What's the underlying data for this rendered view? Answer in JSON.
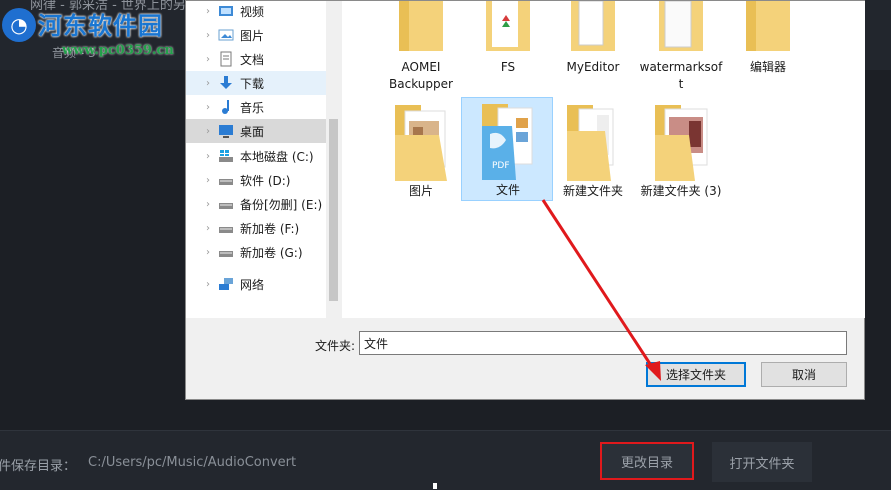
{
  "background_app": {
    "song_title": "网律 - 郭采洁 - 世界上的另",
    "row_text": "音频 - 3",
    "save_dir_label": "件保存目录：",
    "save_dir_path": "C:/Users/pc/Music/AudioConvert",
    "change_dir_button": "更改目录",
    "open_folder_button": "打开文件夹"
  },
  "watermark": {
    "title": "河东软件园",
    "url": "www.pc0359.cn"
  },
  "dialog": {
    "nav": [
      {
        "label": "视频",
        "icon": "video-icon"
      },
      {
        "label": "图片",
        "icon": "pictures-icon"
      },
      {
        "label": "文档",
        "icon": "documents-icon"
      },
      {
        "label": "下载",
        "icon": "download-icon"
      },
      {
        "label": "音乐",
        "icon": "music-icon"
      },
      {
        "label": "桌面",
        "icon": "desktop-icon"
      },
      {
        "label": "本地磁盘 (C:)",
        "icon": "windows-drive-icon"
      },
      {
        "label": "软件 (D:)",
        "icon": "drive-icon"
      },
      {
        "label": "备份[勿删] (E:)",
        "icon": "drive-icon"
      },
      {
        "label": "新加卷 (F:)",
        "icon": "drive-icon"
      },
      {
        "label": "新加卷 (G:)",
        "icon": "drive-icon"
      },
      {
        "label": "网络",
        "icon": "network-icon"
      }
    ],
    "folders_top": [
      {
        "line1": "AOMEI",
        "line2": "Backupper"
      },
      {
        "line1": "FS",
        "line2": ""
      },
      {
        "line1": "MyEditor",
        "line2": ""
      },
      {
        "line1": "watermarksof",
        "line2": "t"
      },
      {
        "line1": "编辑器",
        "line2": ""
      }
    ],
    "folders_bottom": [
      {
        "line1": "图片"
      },
      {
        "line1": "文件"
      },
      {
        "line1": "新建文件夹"
      },
      {
        "line1": "新建文件夹 (3)"
      }
    ],
    "folder_label": "文件夹:",
    "folder_value": "文件",
    "select_button": "选择文件夹",
    "cancel_button": "取消"
  },
  "colors": {
    "highlight_red": "#e0191c",
    "selection_blue": "#cce8ff",
    "folder_yellow": "#f4d27a"
  }
}
